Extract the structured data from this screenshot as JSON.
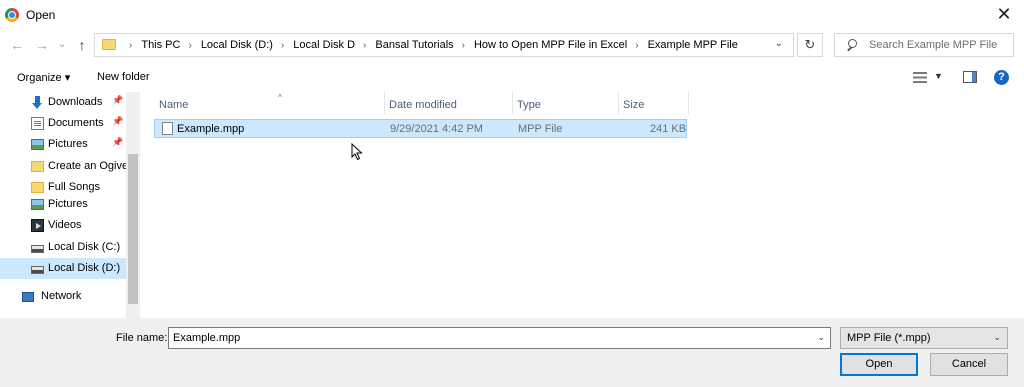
{
  "window": {
    "title": "Open",
    "close_glyph": "✕"
  },
  "nav": {
    "back_glyph": "←",
    "forward_glyph": "→",
    "recent_glyph": "⌄",
    "up_glyph": "↑",
    "breadcrumbs": [
      "This PC",
      "Local Disk (D:)",
      "Local Disk D",
      "Bansal Tutorials",
      "How to Open MPP File in Excel",
      "Example MPP File"
    ],
    "separator": "›",
    "dropdown_glyph": "⌄",
    "refresh_glyph": "↻",
    "search_placeholder": "Search Example MPP File"
  },
  "toolbar": {
    "organize_label": "Organize ▾",
    "new_folder_label": "New folder",
    "help_label": "?"
  },
  "sidebar": {
    "items": [
      {
        "label": "Downloads",
        "icon": "download-icon",
        "pinned": true
      },
      {
        "label": "Documents",
        "icon": "documents-icon",
        "pinned": true
      },
      {
        "label": "Pictures",
        "icon": "pictures-icon",
        "pinned": true
      },
      {
        "label": "Create an Ogive",
        "icon": "folder-icon",
        "pinned": false
      },
      {
        "label": "Full Songs",
        "icon": "folder-icon",
        "pinned": false
      },
      {
        "label": "Pictures",
        "icon": "pictures-icon",
        "pinned": false
      },
      {
        "label": "Videos",
        "icon": "videos-icon",
        "pinned": false
      },
      {
        "label": "Local Disk (C:)",
        "icon": "drive-icon",
        "pinned": false
      },
      {
        "label": "Local Disk (D:)",
        "icon": "drive-icon",
        "pinned": false,
        "selected": true
      },
      {
        "label": "Network",
        "icon": "network-icon",
        "pinned": false
      }
    ],
    "pin_glyph": "📌"
  },
  "columns": [
    "Name",
    "Date modified",
    "Type",
    "Size"
  ],
  "sort_glyph": "^",
  "files": [
    {
      "name": "Example.mpp",
      "date": "9/29/2021 4:42 PM",
      "type": "MPP File",
      "size": "241 KB",
      "selected": true
    }
  ],
  "footer": {
    "file_name_label": "File name:",
    "file_name_value": "Example.mpp",
    "file_type": "MPP File (*.mpp)",
    "dropdown_glyph": "⌄",
    "open_label": "Open",
    "cancel_label": "Cancel"
  },
  "colors": {
    "selection": "#cce8ff",
    "accent": "#0078d7",
    "header_text": "#4c607a"
  }
}
